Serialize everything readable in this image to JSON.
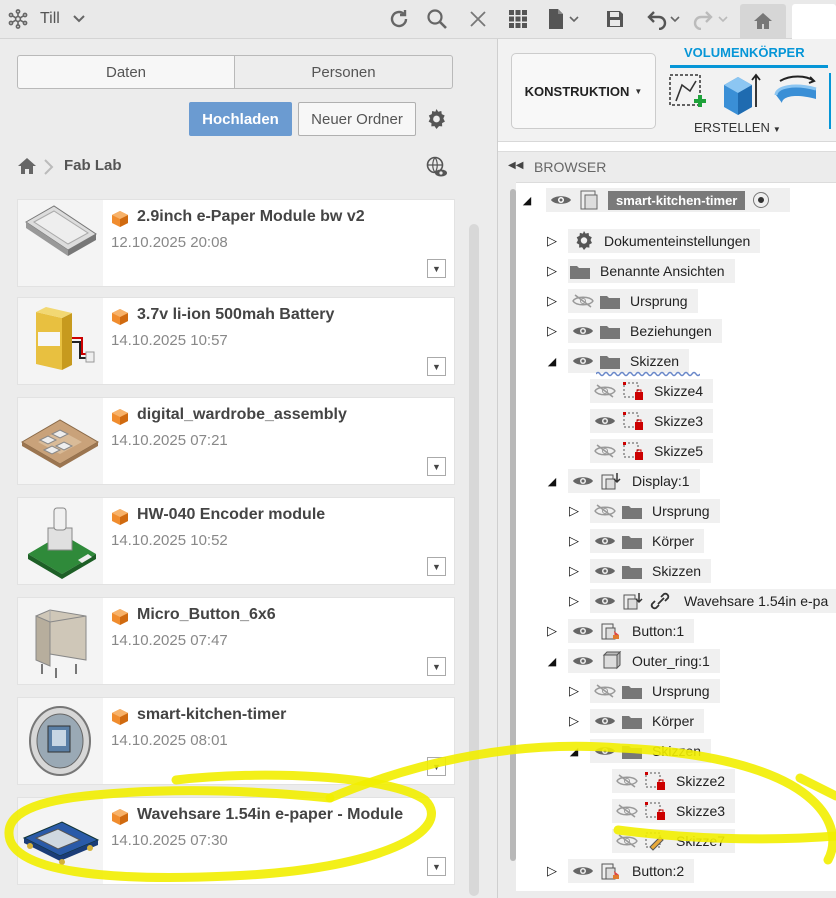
{
  "topbar": {
    "user": "Till",
    "icons": [
      "refresh-icon",
      "search-icon",
      "close-icon",
      "grid-icon",
      "file-icon",
      "save-icon",
      "undo-icon",
      "redo-icon",
      "home-icon"
    ]
  },
  "left": {
    "tabs": [
      "Daten",
      "Personen"
    ],
    "upload_label": "Hochladen",
    "new_folder_label": "Neuer Ordner",
    "breadcrumb": "Fab Lab",
    "cards": [
      {
        "title": "2.9inch e-Paper Module bw v2",
        "date": "12.10.2025 20:08"
      },
      {
        "title": "3.7v li-ion 500mah Battery",
        "date": "14.10.2025 10:57"
      },
      {
        "title": "digital_wardrobe_assembly",
        "date": "14.10.2025 07:21"
      },
      {
        "title": "HW-040 Encoder module",
        "date": "14.10.2025 10:52"
      },
      {
        "title": "Micro_Button_6x6",
        "date": "14.10.2025 07:47"
      },
      {
        "title": "smart-kitchen-timer",
        "date": "14.10.2025 08:01"
      },
      {
        "title": "Wavehsare 1.54in e-paper - Module",
        "date": "14.10.2025 07:30"
      }
    ]
  },
  "right": {
    "konstruktion": "KONSTRUKTION",
    "volumen_tab": "VOLUMENKÖRPER",
    "erstellen": "ERSTELLEN",
    "browser_title": "BROWSER",
    "root": "smart-kitchen-timer",
    "tree": [
      {
        "label": "Dokumenteinstellungen"
      },
      {
        "label": "Benannte Ansichten"
      },
      {
        "label": "Ursprung"
      },
      {
        "label": "Beziehungen"
      },
      {
        "label": "Skizzen"
      },
      {
        "label": "Skizze4"
      },
      {
        "label": "Skizze3"
      },
      {
        "label": "Skizze5"
      },
      {
        "label": "Display:1"
      },
      {
        "label": "Ursprung"
      },
      {
        "label": "Körper"
      },
      {
        "label": "Skizzen"
      },
      {
        "label": "Wavehsare 1.54in e-pa"
      },
      {
        "label": "Button:1"
      },
      {
        "label": "Outer_ring:1"
      },
      {
        "label": "Ursprung"
      },
      {
        "label": "Körper"
      },
      {
        "label": "Skizzen"
      },
      {
        "label": "Skizze2"
      },
      {
        "label": "Skizze3"
      },
      {
        "label": "Skizze7"
      },
      {
        "label": "Button:2"
      }
    ]
  },
  "colors": {
    "accent": "#0696d7",
    "upload": "#6b9bd1",
    "highlight": "#f2ee00",
    "cube": "#f08c2e"
  }
}
